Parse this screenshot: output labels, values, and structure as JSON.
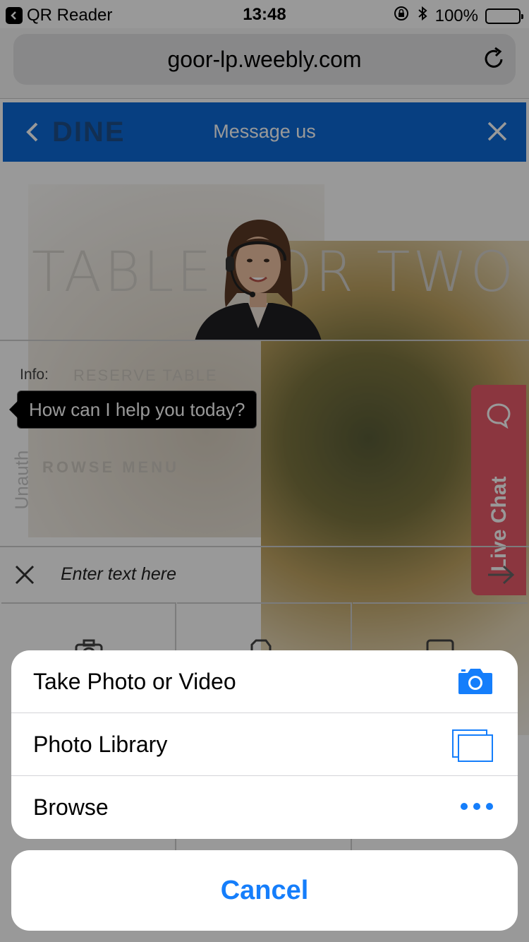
{
  "status_bar": {
    "back_app": "QR Reader",
    "time": "13:48",
    "battery": "100%"
  },
  "browser": {
    "url": "goor-lp.weebly.com"
  },
  "page": {
    "brand_ghost": "DINE",
    "hero_title": "TABLE FOR TWO",
    "reserve_link": "RESERVE TABLE",
    "browse_link": "ROWSE MENU"
  },
  "chat": {
    "header_title": "Message us",
    "info_label": "Info:",
    "bubble_text": "How can I help you today?",
    "side_label": "Unauth",
    "live_chat_tab": "Live Chat",
    "input_placeholder": "Enter text here",
    "accent_color": "#0d6ad8"
  },
  "action_sheet": {
    "options": [
      {
        "label": "Take Photo or Video",
        "icon": "camera-icon"
      },
      {
        "label": "Photo Library",
        "icon": "photo-library-icon"
      },
      {
        "label": "Browse",
        "icon": "more-dots-icon"
      }
    ],
    "cancel_label": "Cancel",
    "tint_color": "#157efb"
  }
}
